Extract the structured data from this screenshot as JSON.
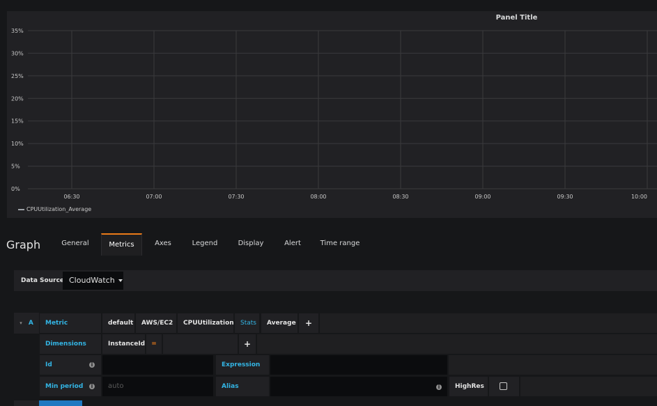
{
  "panel": {
    "title": "Panel Title",
    "legend_label": "CPUUtilization_Average"
  },
  "chart_data": {
    "type": "line",
    "title": "Panel Title",
    "x_ticks": [
      "06:30",
      "07:00",
      "07:30",
      "08:00",
      "08:30",
      "09:00",
      "09:30",
      "10:00"
    ],
    "y_ticks": [
      "0%",
      "5%",
      "10%",
      "15%",
      "20%",
      "25%",
      "30%",
      "35%"
    ],
    "ylim": [
      0,
      35
    ],
    "grid": true,
    "legend_placement": "bottom-left",
    "series": [
      {
        "name": "CPUUtilization_Average",
        "values": []
      }
    ]
  },
  "editor": {
    "title": "Graph",
    "tabs": [
      "General",
      "Metrics",
      "Axes",
      "Legend",
      "Display",
      "Alert",
      "Time range"
    ],
    "active_tab": "Metrics"
  },
  "datasource": {
    "label": "Data Source",
    "value": "CloudWatch"
  },
  "query": {
    "ref": "A",
    "collapse_icon": "chevron-down-icon",
    "metric_label": "Metric",
    "region": "default",
    "namespace": "AWS/EC2",
    "metric_name": "CPUUtilization",
    "stats_label": "Stats",
    "stat": "Average",
    "add": "+",
    "dimensions_label": "Dimensions",
    "dimension_key": "InstanceId",
    "dimension_op": "=",
    "id_label": "Id",
    "expression_label": "Expression",
    "min_period_label": "Min period",
    "min_period_placeholder": "auto",
    "alias_label": "Alias",
    "highres_label": "HighRes",
    "info": "i"
  },
  "colors": {
    "accent": "#33b5e5",
    "active_tab": "#eb7b18",
    "background": "#161719",
    "panel": "#212124"
  }
}
